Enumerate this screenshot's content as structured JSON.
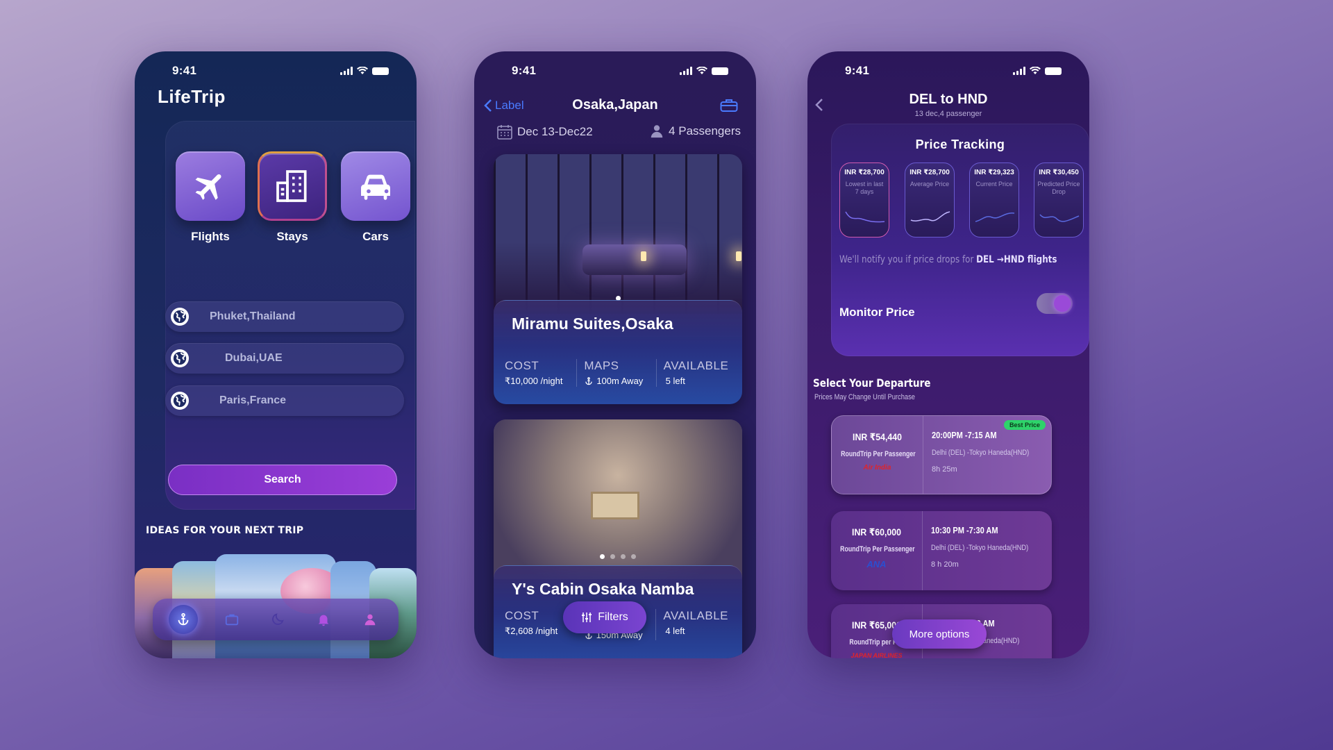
{
  "status": {
    "time": "9:41"
  },
  "home": {
    "app_title": "LifeTrip",
    "categories": [
      {
        "label": "Flights",
        "icon": "airplane-icon"
      },
      {
        "label": "Stays",
        "icon": "building-icon"
      },
      {
        "label": "Cars",
        "icon": "car-icon"
      }
    ],
    "destinations": [
      {
        "value": "Phuket,Thailand",
        "icon": "globe-icon"
      },
      {
        "value": "Dubai,UAE",
        "icon": "globe-icon"
      },
      {
        "value": "Paris,France",
        "icon": "globe-icon"
      }
    ],
    "search_label": "Search",
    "ideas_heading": "IDEAS FOR  YOUR NEXT TRIP",
    "tabbar": [
      "anchor-icon",
      "briefcase-icon",
      "moon-icon",
      "bell-icon",
      "user-icon"
    ]
  },
  "hotels": {
    "back_label": "Label",
    "title": "Osaka,Japan",
    "dates": "Dec 13-Dec22",
    "passengers": "4 Passengers",
    "cards": [
      {
        "name": "Miramu Suites,Osaka",
        "cost_label": "COST",
        "cost": "₹10,000 /night",
        "maps_label": "MAPS",
        "distance": "100m Away",
        "available_label": "AVAILABLE",
        "available": "5 left"
      },
      {
        "name": "Y's Cabin Osaka Namba",
        "cost_label": "COST",
        "cost": "₹2,608 /night",
        "distance": "150m Away",
        "available_label": "AVAILABLE",
        "available": "4 left"
      }
    ],
    "filters_label": "Filters"
  },
  "flights": {
    "title": "DEL to HND",
    "subtitle": "13 dec,4 passenger",
    "tracking_title": "Price Tracking",
    "tracking_cards": [
      {
        "amount": "INR ₹28,700",
        "caption": "Lowest in last 7 days"
      },
      {
        "amount": "INR ₹28,700",
        "caption": "Average Price"
      },
      {
        "amount": "INR ₹29,323",
        "caption": "Current Price"
      },
      {
        "amount": "INR ₹30,450",
        "caption": "Predicted Price Drop"
      }
    ],
    "notify_prefix": "We'll notify you if price drops for",
    "notify_route": "DEL →HND flights",
    "monitor_label": "Monitor Price",
    "monitor_on": true,
    "departure_title": "Select Your Departure",
    "departure_sub": "Prices May Change Until Purchase",
    "options": [
      {
        "price": "INR ₹54,440",
        "type": "RoundTrip Per Passenger",
        "airline": "Air India",
        "times": "20:00PM -7:15 AM",
        "route": "Delhi (DEL) -Tokyo Haneda(HND)",
        "duration": "8h 25m",
        "badge": "Best Price",
        "airline_color": "#e0242a"
      },
      {
        "price": "INR ₹60,000",
        "type": "RoundTrip Per Passenger",
        "airline": "ANA",
        "times": "10:30 PM -7:30 AM",
        "route": "Delhi (DEL) -Tokyo Haneda(HND)",
        "duration": "8 h  20m",
        "airline_color": "#2a4fd0"
      },
      {
        "price": "INR ₹65,000",
        "type": "RoundTrip per Pas",
        "airline": "JAPAN AIRLINES",
        "times": "30 AM",
        "route": "kyo Haneda(HND)",
        "airline_color": "#e0242a"
      }
    ],
    "more_label": "More options"
  }
}
